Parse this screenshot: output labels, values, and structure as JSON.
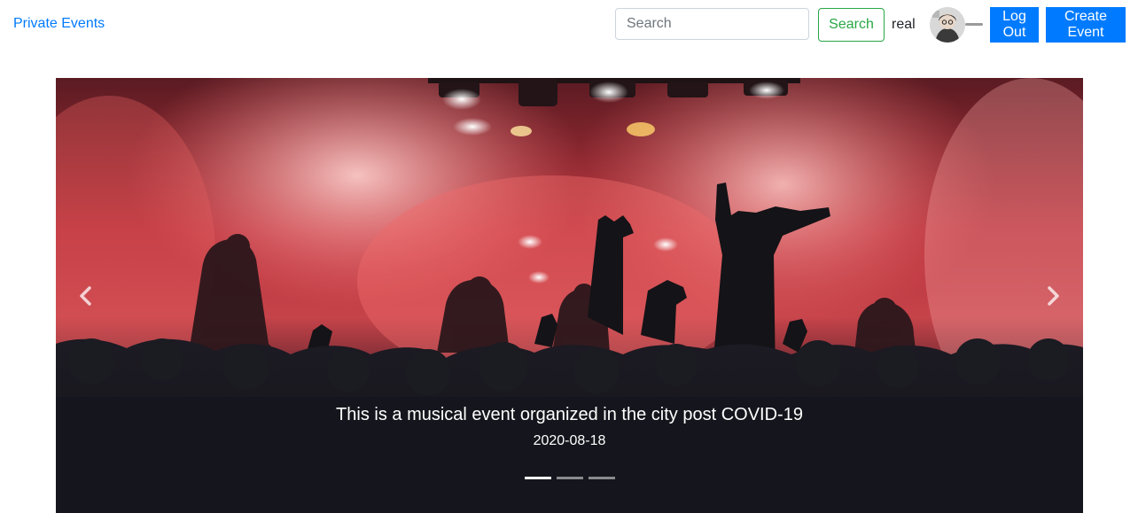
{
  "nav": {
    "brand": "Private Events",
    "search_placeholder": "Search",
    "search_value": "",
    "search_button": "Search",
    "username": "real",
    "logout_button": "Log Out",
    "create_button": "Create Event"
  },
  "carousel": {
    "active_index": 0,
    "slides": [
      {
        "caption": "This is a musical event organized in the city post COVID-19",
        "date": "2020-08-18"
      }
    ],
    "indicator_count": 3,
    "prev_icon": "chevron-left-icon",
    "next_icon": "chevron-right-icon"
  },
  "colors": {
    "link": "#007bff",
    "primary": "#007bff",
    "success": "#28a745",
    "stage_red": "#e3393f",
    "crowd_dark": "#161821"
  }
}
